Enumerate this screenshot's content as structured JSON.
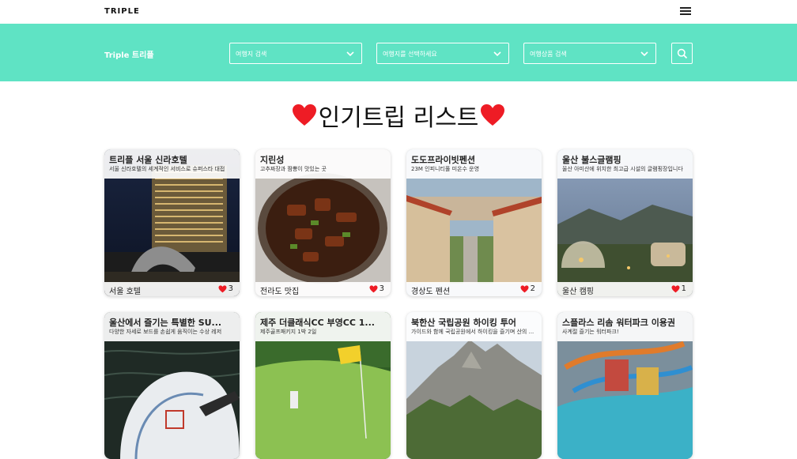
{
  "nav": {
    "logo": "TRIPLE",
    "menu_icon": "hamburger-icon"
  },
  "search": {
    "brand": "Triple 트리플",
    "selects": [
      {
        "placeholder": "여행지 검색"
      },
      {
        "placeholder": "여행지를 선택하세요"
      },
      {
        "placeholder": "여행상품 검색"
      }
    ],
    "search_icon": "search-icon",
    "accent_color": "#5fe3c4"
  },
  "main": {
    "heading": "인기트립 리스트",
    "heart_color": "#ee1c25"
  },
  "cards": [
    {
      "title": "트리플 서울 신라호텔",
      "desc": "서울 신라호텔의 세계적인 서비스로 슈퍼스타 대접",
      "category": "서울 호텔",
      "likes": "3"
    },
    {
      "title": "지린성",
      "desc": "고추짜장과 짬뽕이 맛있는 곳",
      "category": "전라도 맛집",
      "likes": "3"
    },
    {
      "title": "도도프라이빗펜션",
      "desc": "23M 인피니티풀 미온수 운영",
      "category": "경상도 펜션",
      "likes": "2"
    },
    {
      "title": "울산 불스글램핑",
      "desc": "울산 아미산에 위치한 최고급 시설의 글램핑장입니다",
      "category": "울산 캠핑",
      "likes": "1"
    },
    {
      "title": "울산에서 즐기는 특별한 SU...",
      "desc": "다양한 자세로 보드를 손쉽게 움직이는 수상 레저",
      "category": "",
      "likes": ""
    },
    {
      "title": "제주 더클래식CC 부영CC 1...",
      "desc": "제주골프패키지 1박 2일",
      "category": "",
      "likes": ""
    },
    {
      "title": "북한산 국립공원 하이킹 투어",
      "desc": "가이드와 함께 국립공원에서 하이킹을 즐기며 산의 ...",
      "category": "",
      "likes": ""
    },
    {
      "title": "스플라스 리솜 워터파크 이용권",
      "desc": "사계절 즐기는 워터파크!",
      "category": "",
      "likes": ""
    }
  ]
}
